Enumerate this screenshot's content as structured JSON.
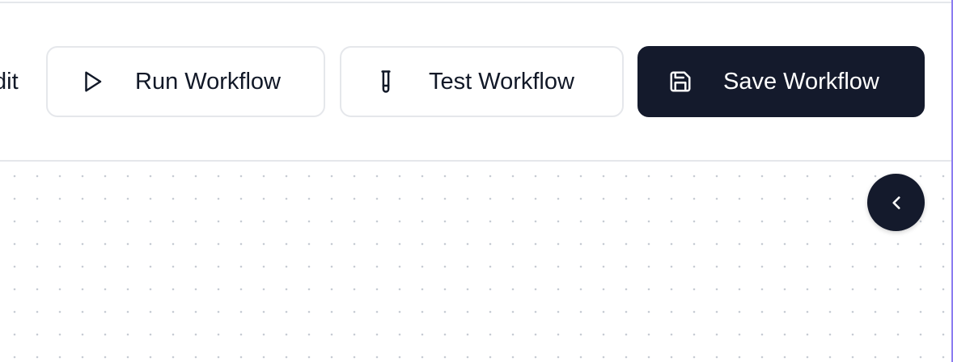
{
  "toolbar": {
    "partial_label": "dit",
    "run": {
      "label": "Run Workflow",
      "icon": "play-icon"
    },
    "test": {
      "label": "Test Workflow",
      "icon": "test-tube-icon"
    },
    "save": {
      "label": "Save Workflow",
      "icon": "save-icon"
    }
  },
  "canvas": {
    "collapse_button_icon": "chevron-left-icon"
  },
  "colors": {
    "primary_dark": "#141a2c",
    "border": "#e5e7eb",
    "accent": "#8b7cf0"
  }
}
